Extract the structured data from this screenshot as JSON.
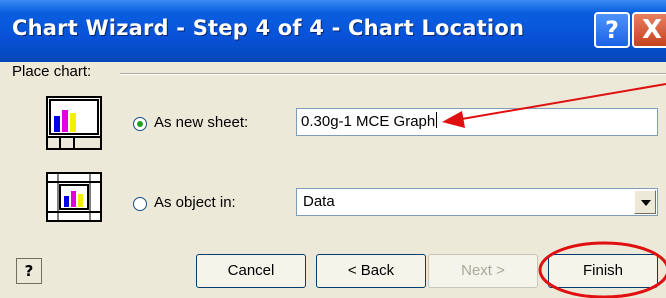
{
  "window": {
    "title": "Chart Wizard - Step 4 of 4 - Chart Location",
    "help_button": "?",
    "close_button": "X"
  },
  "group": {
    "label": "Place chart:"
  },
  "options": {
    "new_sheet": {
      "label": "As new sheet:",
      "checked": true,
      "value": "0.30g-1 MCE Graph"
    },
    "object_in": {
      "label": "As object in:",
      "checked": false,
      "value": "Data"
    }
  },
  "buttons": {
    "help": "?",
    "cancel": "Cancel",
    "back": "< Back",
    "next": "Next >",
    "finish": "Finish"
  },
  "annotations": {
    "colors": {
      "arrow": "#e01010",
      "circle": "#e01010"
    }
  }
}
